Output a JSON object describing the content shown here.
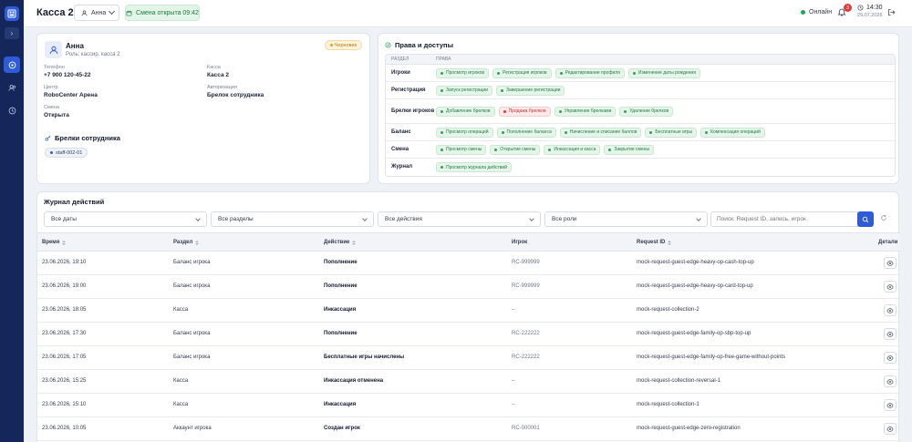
{
  "header": {
    "title": "Касса 2",
    "user": "Анна",
    "shift_status": "Смена открыта 09:42",
    "online": "Онлайн",
    "notifications": "3",
    "time": "14:30",
    "date": "29.07.2026"
  },
  "profile": {
    "name": "Анна",
    "subtitle": "Роль: кассир, касса 2",
    "status": "Черновик",
    "fields": [
      {
        "label": "Телефон",
        "value": "+7 900 120-45-22"
      },
      {
        "label": "Касса",
        "value": "Касса 2"
      },
      {
        "label": "Центр",
        "value": "RoboCenter Арена"
      },
      {
        "label": "Авторизация",
        "value": "Брелок сотрудника"
      },
      {
        "label": "Смена",
        "value": "Открыта"
      }
    ],
    "keys_title": "Брелки сотрудника",
    "key": "staff-002-01"
  },
  "rights": {
    "title": "Права и доступы",
    "col_section": "РАЗДЕЛ",
    "col_rights": "ПРАВА",
    "rows": [
      {
        "section": "Игроки",
        "chips": [
          {
            "label": "Просмотр игроков",
            "denied": false
          },
          {
            "label": "Регистрация игроков",
            "denied": false
          },
          {
            "label": "Редактирование профиля",
            "denied": false
          },
          {
            "label": "Изменение даты рождения",
            "denied": false
          }
        ]
      },
      {
        "section": "Регистрация",
        "chips": [
          {
            "label": "Запуск регистрации",
            "denied": false
          },
          {
            "label": "Завершение регистрации",
            "denied": false
          }
        ]
      },
      {
        "section": "Брелки игроков",
        "chips": [
          {
            "label": "Добавление брелков",
            "denied": false
          },
          {
            "label": "Продажа брелков",
            "denied": true
          },
          {
            "label": "Управление брелками",
            "denied": false
          },
          {
            "label": "Удаление брелков",
            "denied": false
          }
        ]
      },
      {
        "section": "Баланс",
        "chips": [
          {
            "label": "Просмотр операций",
            "denied": false
          },
          {
            "label": "Пополнение баланса",
            "denied": false
          },
          {
            "label": "Начисление и списание баллов",
            "denied": false
          },
          {
            "label": "Бесплатные игры",
            "denied": false
          },
          {
            "label": "Компенсация операций",
            "denied": false
          }
        ]
      },
      {
        "section": "Смена",
        "chips": [
          {
            "label": "Просмотр смены",
            "denied": false
          },
          {
            "label": "Открытие смены",
            "denied": false
          },
          {
            "label": "Инкассация и касса",
            "denied": false
          },
          {
            "label": "Закрытие смены",
            "denied": false
          }
        ]
      },
      {
        "section": "Журнал",
        "chips": [
          {
            "label": "Просмотр журнала действий",
            "denied": false
          }
        ]
      }
    ]
  },
  "journal": {
    "title": "Журнал действий",
    "filters": {
      "dates": "Все даты",
      "sections": "Все разделы",
      "actions": "Все действия",
      "roles": "Все роли",
      "search_placeholder": "Поиск: Request ID, запись, игрок"
    },
    "columns": {
      "time": "Время",
      "section": "Раздел",
      "action": "Действие",
      "player": "Игрок",
      "request": "Request ID",
      "details": "Детали"
    },
    "rows": [
      {
        "time": "23.06.2026, 19:10",
        "section": "Баланс игрока",
        "action": "Пополнение",
        "player": "RC-999999",
        "request": "mock-request-guest-edge-heavy-op-cash-top-up"
      },
      {
        "time": "23.06.2026, 19:00",
        "section": "Баланс игрока",
        "action": "Пополнение",
        "player": "RC-999999",
        "request": "mock-request-guest-edge-heavy-op-card-top-up"
      },
      {
        "time": "23.06.2026, 18:05",
        "section": "Касса",
        "action": "Инкассация",
        "player": "–",
        "request": "mock-request-collection-2"
      },
      {
        "time": "23.06.2026, 17:30",
        "section": "Баланс игрока",
        "action": "Пополнение",
        "player": "RC-222222",
        "request": "mock-request-guest-edge-family-op-sbp-top-up"
      },
      {
        "time": "23.06.2026, 17:05",
        "section": "Баланс игрока",
        "action": "Бесплатные игры начислены",
        "player": "RC-222222",
        "request": "mock-request-guest-edge-family-op-free-game-without-points"
      },
      {
        "time": "23.06.2026, 15:25",
        "section": "Касса",
        "action": "Инкассация отменена",
        "player": "–",
        "request": "mock-request-collection-reversal-1"
      },
      {
        "time": "23.06.2026, 15:10",
        "section": "Касса",
        "action": "Инкассация",
        "player": "–",
        "request": "mock-request-collection-1"
      },
      {
        "time": "23.06.2026, 10:05",
        "section": "Аккаунт игрока",
        "action": "Создан игрок",
        "player": "RC-000001",
        "request": "mock-request-guest-edge-zero-registration"
      }
    ]
  }
}
